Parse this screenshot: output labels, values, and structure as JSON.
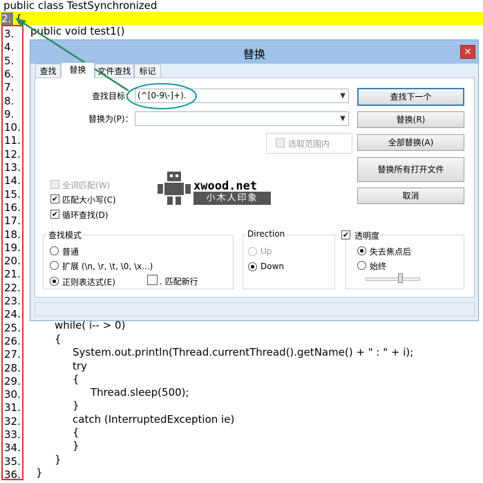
{
  "editor": {
    "line1": "public class TestSynchronized",
    "line2_number": "2.",
    "line2_code": "{",
    "line3_code": "public void test1()",
    "line_numbers": [
      "3.",
      "4.",
      "5.",
      "6.",
      "7.",
      "8.",
      "9.",
      "10.",
      "11.",
      "12.",
      "13.",
      "14.",
      "15.",
      "16.",
      "17.",
      "18.",
      "19.",
      "20.",
      "21.",
      "22.",
      "23.",
      "24.",
      "25.",
      "26.",
      "27.",
      "28.",
      "29.",
      "30.",
      "31.",
      "32.",
      "33.",
      "34.",
      "35.",
      "36."
    ],
    "code_lines": [
      "while( i-- > 0)",
      "{",
      "System.out.println(Thread.currentThread().getName() + \" : \" + i);",
      "try",
      "{",
      "Thread.sleep(500);",
      "}",
      "catch (InterruptedException ie)",
      "{",
      "}",
      "}",
      "}"
    ]
  },
  "dialog": {
    "title": "替换",
    "close": "✕",
    "tabs": [
      "查找",
      "替换",
      "文件查找",
      "标记"
    ],
    "find_label": "查找目标：",
    "find_value": "(^[0-9\\-]+).",
    "replace_label": "替换为(P)：",
    "replace_value": "",
    "in_selection": "选取范围内",
    "buttons": {
      "find_next": "查找下一个",
      "replace": "替换(R)",
      "replace_all": "全部替换(A)",
      "replace_all_open": "替换所有打开文件",
      "cancel": "取消"
    },
    "options": {
      "whole_word": "全词匹配(W)",
      "match_case": "匹配大小写(C)",
      "wrap": "循环查找(D)"
    },
    "search_mode": {
      "title": "查找模式",
      "normal": "普通",
      "extended": "扩展 (\\n, \\r, \\t, \\0, \\x...)",
      "regex": "正则表达式(E)",
      "dot_newline": ". 匹配新行"
    },
    "direction": {
      "title": "Direction",
      "up": "Up",
      "down": "Down"
    },
    "transparency": {
      "title": "透明度",
      "on_lose_focus": "失去焦点后",
      "always": "始终",
      "level": 0.65
    },
    "watermark": {
      "text": "xwood.net",
      "cn": "小木人印象"
    }
  },
  "colors": {
    "highlight": "#ffff00",
    "gutter_border": "#e03030",
    "annotation": "#2e8b57",
    "annotation_ellipse": "#1a9aa0"
  }
}
